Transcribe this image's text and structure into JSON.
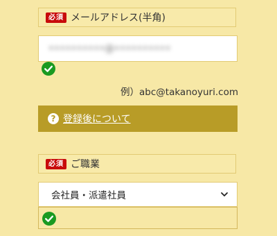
{
  "email": {
    "required_badge": "必須",
    "label": "メールアドレス(半角)",
    "value": "••••••••••@••••••••••",
    "status_icon": "check-circle-icon",
    "example": "例）abc@takanoyuri.com"
  },
  "help": {
    "icon": "question-circle-icon",
    "link_text": "登録後について"
  },
  "occupation": {
    "required_badge": "必須",
    "label": "ご職業",
    "selected_value": "会社員・派遣社員",
    "dropdown_icon": "chevron-down-icon",
    "status_icon": "check-circle-icon"
  },
  "colors": {
    "page_background": "#f7e8a6",
    "required_badge": "#c80b0b",
    "help_bar": "#b89c27",
    "check_green": "#1a9a21"
  }
}
